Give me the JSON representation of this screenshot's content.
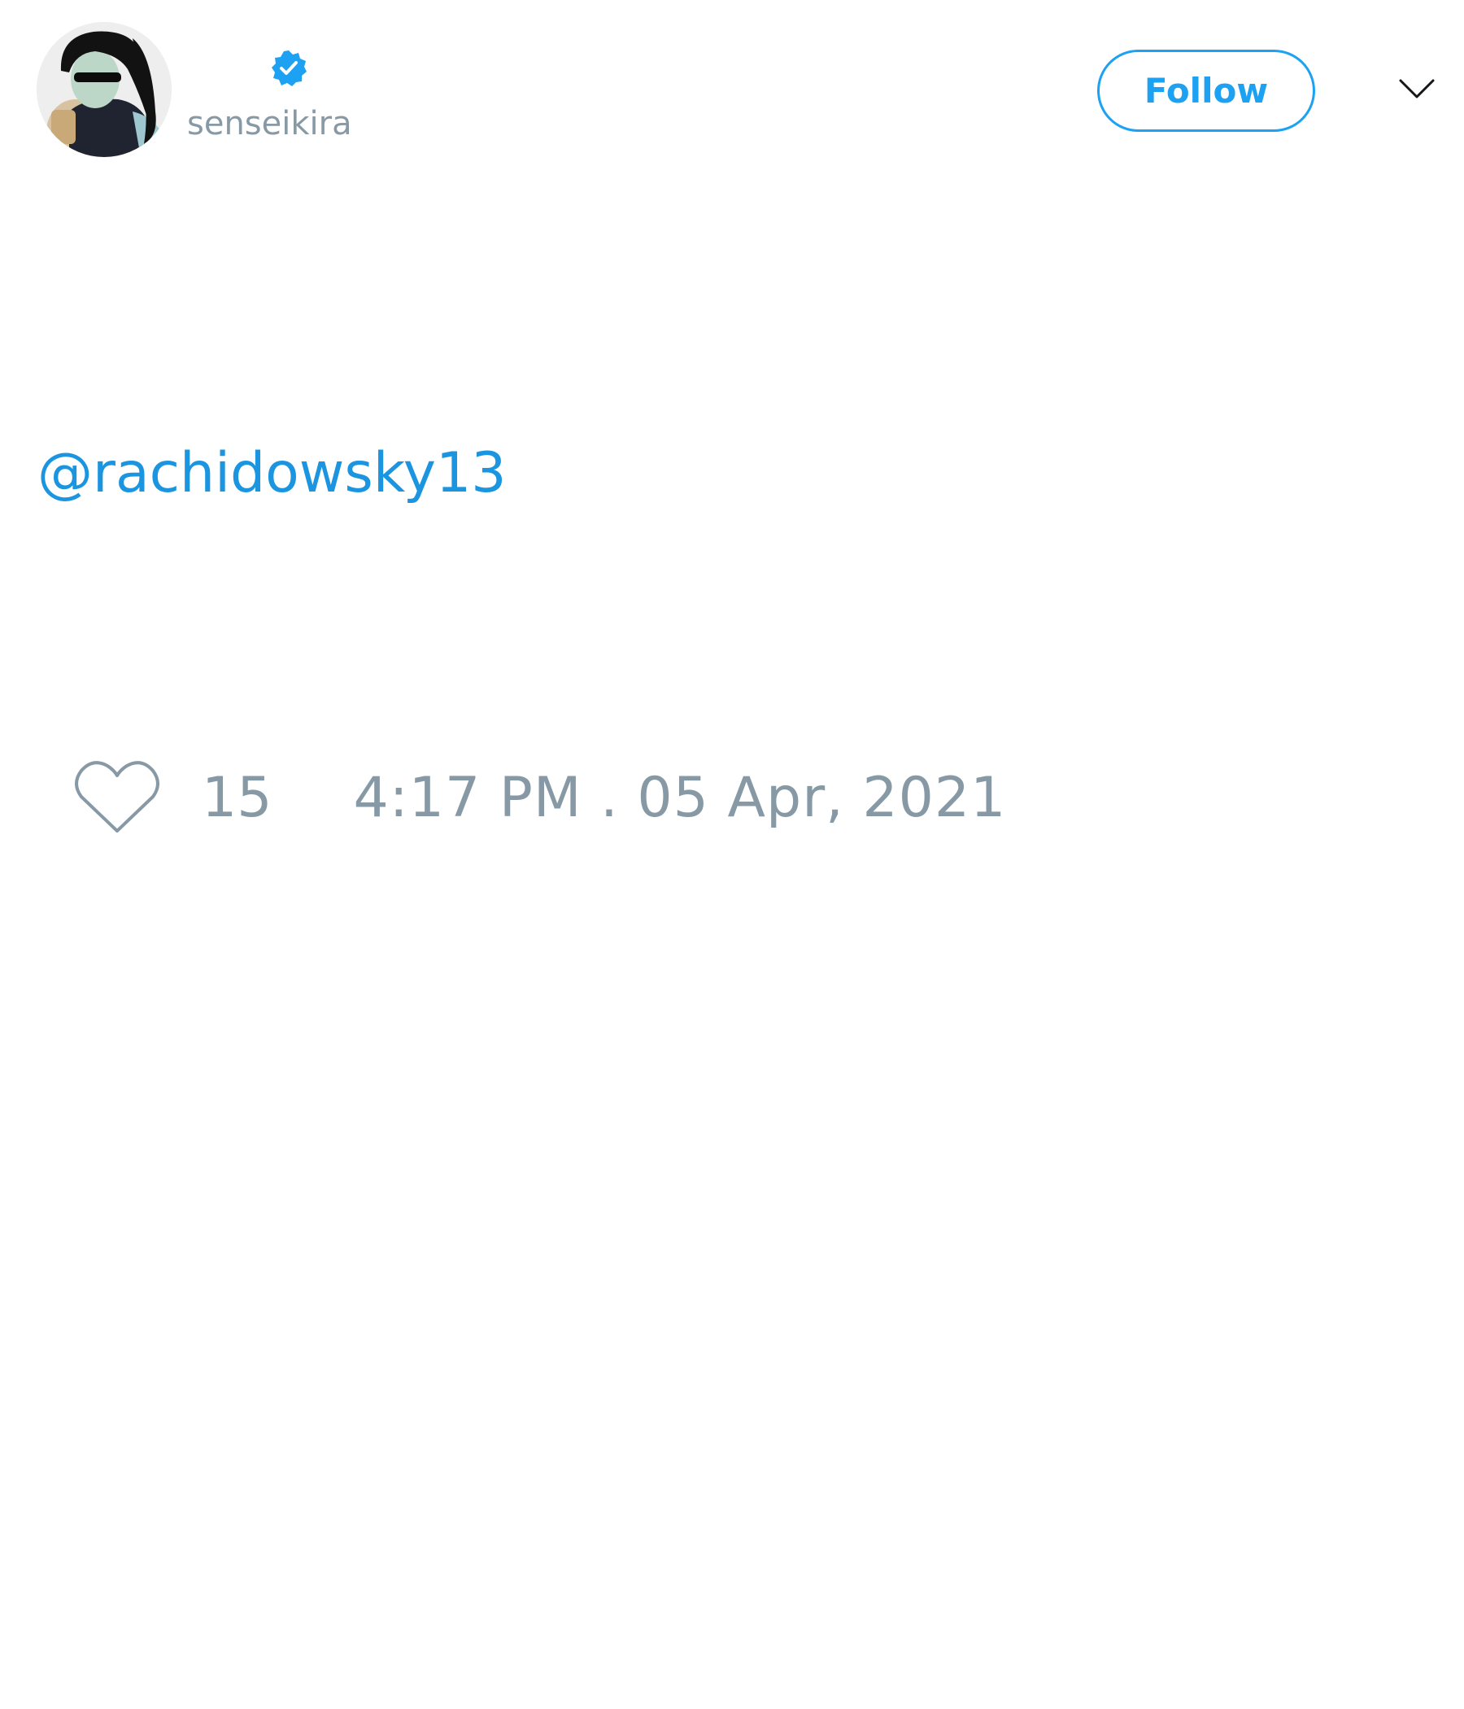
{
  "author": {
    "display_name": "",
    "username": "senseikira",
    "verified": true,
    "avatar_icon": "profile-photo"
  },
  "header": {
    "follow_label": "Follow",
    "menu_icon": "chevron-down-icon"
  },
  "tweet": {
    "text": "@rachidowsky13"
  },
  "footer": {
    "like_icon": "heart-outline-icon",
    "like_count": "15",
    "timestamp": "4:17 PM . 05 Apr, 2021"
  },
  "colors": {
    "accent": "#1da1f2",
    "link": "#1b95e0",
    "muted": "#8899a6",
    "background": "#ffffff"
  }
}
